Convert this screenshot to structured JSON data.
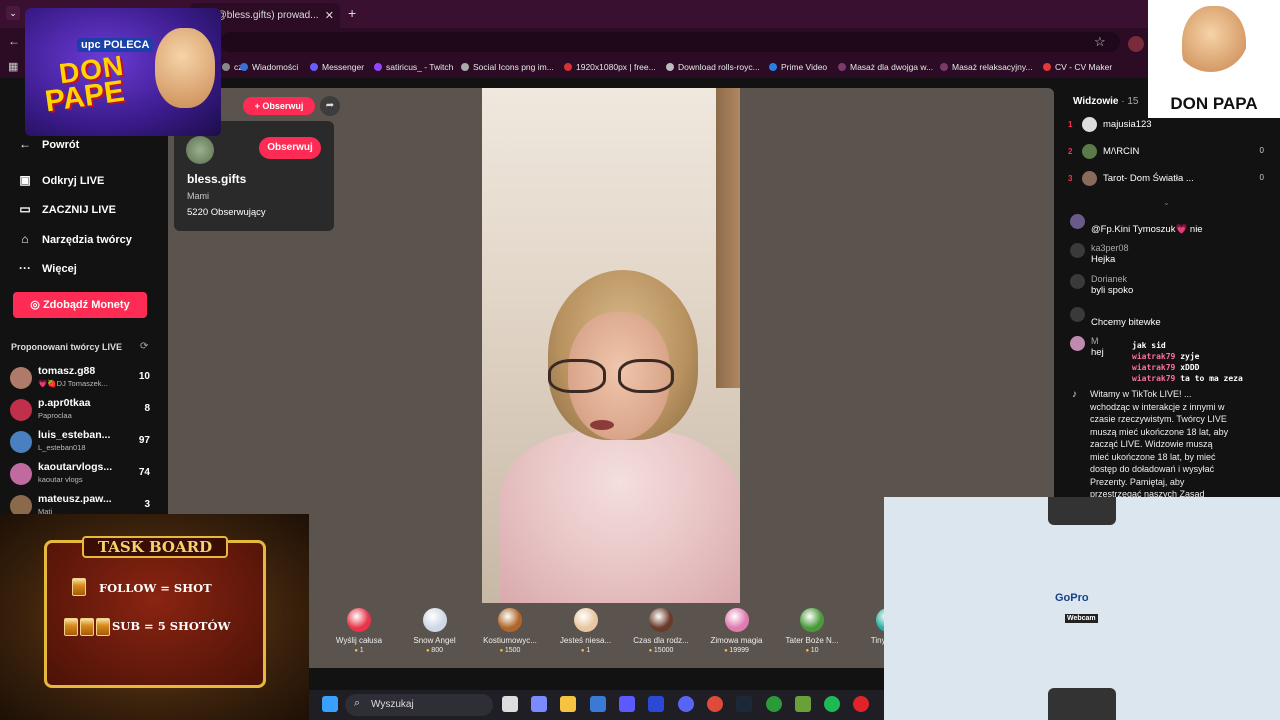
{
  "browser": {
    "tab_title": "mi (@bless.gifts) prowad...",
    "bookmarks": [
      {
        "label": "cz",
        "color": "#888888"
      },
      {
        "label": "Wiadomości",
        "color": "#3b6fd6"
      },
      {
        "label": "Messenger",
        "color": "#6a5cff"
      },
      {
        "label": "satiricus_ - Twitch",
        "color": "#9146ff"
      },
      {
        "label": "Social Icons png im...",
        "color": "#aaaaaa"
      },
      {
        "label": "1920x1080px | free...",
        "color": "#d33333"
      },
      {
        "label": "Download rolls-royc...",
        "color": "#bbbbbb"
      },
      {
        "label": "Prime Video",
        "color": "#2a7de1"
      },
      {
        "label": "Masaż dla dwojga w...",
        "color": "#7a3a6a"
      },
      {
        "label": "Masaż relaksacyjny...",
        "color": "#7a3a6a"
      },
      {
        "label": "CV - CV Maker",
        "color": "#e03a3a"
      }
    ]
  },
  "sidebar": {
    "back": "Powrót",
    "items": [
      {
        "label": "Odkryj LIVE",
        "icon": "calendar-icon"
      },
      {
        "label": "ZACZNIJ LIVE",
        "icon": "video-camera-icon"
      },
      {
        "label": "Narzędzia twórcy",
        "icon": "home-icon"
      },
      {
        "label": "Więcej",
        "icon": "more-icon"
      }
    ],
    "coins_button": "Zdobądź Monety",
    "suggested_header": "Proponowani twórcy LIVE",
    "suggested": [
      {
        "name": "tomasz.g88",
        "sub": "💗🍓DJ Tomaszek...",
        "count": "10",
        "color": "#b07a6a"
      },
      {
        "name": "p.apr0tkaa",
        "sub": "Paproclaa",
        "count": "8",
        "color": "#c0304a"
      },
      {
        "name": "luis_esteban...",
        "sub": "L_esteban018",
        "count": "97",
        "color": "#4a7fc0"
      },
      {
        "name": "kaoutarvlogs...",
        "sub": "kaoutar vlogs",
        "count": "74",
        "color": "#c06aa0"
      },
      {
        "name": "mateusz.paw...",
        "sub": "Mati",
        "count": "3",
        "color": "#8a6a4a"
      }
    ]
  },
  "host": {
    "follow_small": "+ Obserwuj",
    "follow": "Obserwuj",
    "username": "bless.gifts",
    "nickname": "Mami",
    "followers": "5220 Obserwujący"
  },
  "gifts": [
    {
      "name": "Wyślij całusa",
      "price": "1",
      "color": "#e8354a"
    },
    {
      "name": "Snow Angel",
      "price": "800",
      "color": "#cfd8e6"
    },
    {
      "name": "Kostiumowyc...",
      "price": "1500",
      "color": "#b0662a"
    },
    {
      "name": "Jesteś niesa...",
      "price": "1",
      "color": "#e6c8a0"
    },
    {
      "name": "Czas dla rodz...",
      "price": "15000",
      "color": "#6a3a2a"
    },
    {
      "name": "Zimowa magia",
      "price": "19999",
      "color": "#e07ab0"
    },
    {
      "name": "Tater Boże N...",
      "price": "10",
      "color": "#4a9a3a"
    },
    {
      "name": "Tiny Be...",
      "price": "",
      "color": "#2ab0a0"
    }
  ],
  "viewers": {
    "header": "Widzowie",
    "count": "15",
    "list": [
      {
        "rank": "1",
        "name": "majusia123",
        "score": "",
        "color": "#dddddd"
      },
      {
        "rank": "2",
        "name": "M/\\RCIN",
        "score": "0",
        "color": "#5a7a4a"
      },
      {
        "rank": "3",
        "name": "Tarot- Dom Światła ...",
        "score": "0",
        "color": "#8a6a5a"
      }
    ]
  },
  "chat": [
    {
      "user": "",
      "text": "@Fp.Kini Tymoszuk💗 nie",
      "color": "#6a5a8a"
    },
    {
      "user": "ka3per08",
      "text": "Hejka",
      "color": "#3a3a3a"
    },
    {
      "user": "Dorianek",
      "text": "byli spoko",
      "color": "#3a3a3a"
    },
    {
      "user": "",
      "text": "Chcemy bitewke",
      "color": "#3a3a3a"
    },
    {
      "user": "M",
      "text": "hej",
      "color": "#c08ab0"
    }
  ],
  "system_message": "Witamy w TikTok LIVE! ... wchodząc w interakcje z innymi w czasie rzeczywistym. Twórcy LIVE muszą mieć ukończone 18 lat, aby zacząć LIVE. Widzowie muszą mieć ukończone 18 lat, by mieć dostęp do doładowań i wysyłać Prezenty. Pamiętaj, aby przestrzegać naszych Zasad społeczności.",
  "tag_overlay": {
    "lines": [
      {
        "nick": "",
        "msg": "jak sid"
      },
      {
        "nick": "wiatrak79",
        "msg": "zyje"
      },
      {
        "nick": "wiatrak79",
        "msg": "xDDD"
      },
      {
        "nick": "wiatrak79",
        "msg": "ta to ma zeza"
      }
    ]
  },
  "overlays": {
    "logo_badge": "upc POLECA",
    "logo_line1": "DON",
    "logo_line2": "PAPE",
    "brand": "DON PAPA",
    "task_title": "TASK BOARD",
    "task_1": "FOLLOW = SHOT",
    "task_2": "SUB = 5 SHOTÓW",
    "gopro": "GoPro",
    "gopro_sub": "Webcam"
  },
  "taskbar": {
    "search_placeholder": "Wyszukaj",
    "apps": [
      {
        "icon": "windows-icon",
        "color": "#3aa0ff"
      },
      {
        "icon": "task-view-icon",
        "color": "#dddddd"
      },
      {
        "icon": "copilot-icon",
        "color": "#7a8aff"
      },
      {
        "icon": "file-explorer-icon",
        "color": "#f5c242"
      },
      {
        "icon": "store-icon",
        "color": "#3a7ad6"
      },
      {
        "icon": "vpn-icon",
        "color": "#5a5aff"
      },
      {
        "icon": "l-app-icon",
        "color": "#2a4ad6"
      },
      {
        "icon": "discord-icon",
        "color": "#5865f2"
      },
      {
        "icon": "chrome-icon",
        "color": "#e04a3a"
      },
      {
        "icon": "steam-icon",
        "color": "#1b2838"
      },
      {
        "icon": "xbox-icon",
        "color": "#2a9a3a"
      },
      {
        "icon": "minecraft-icon",
        "color": "#6aa03a"
      },
      {
        "icon": "spotify-icon",
        "color": "#1db954"
      },
      {
        "icon": "opera-icon",
        "color": "#e0222a"
      }
    ]
  }
}
